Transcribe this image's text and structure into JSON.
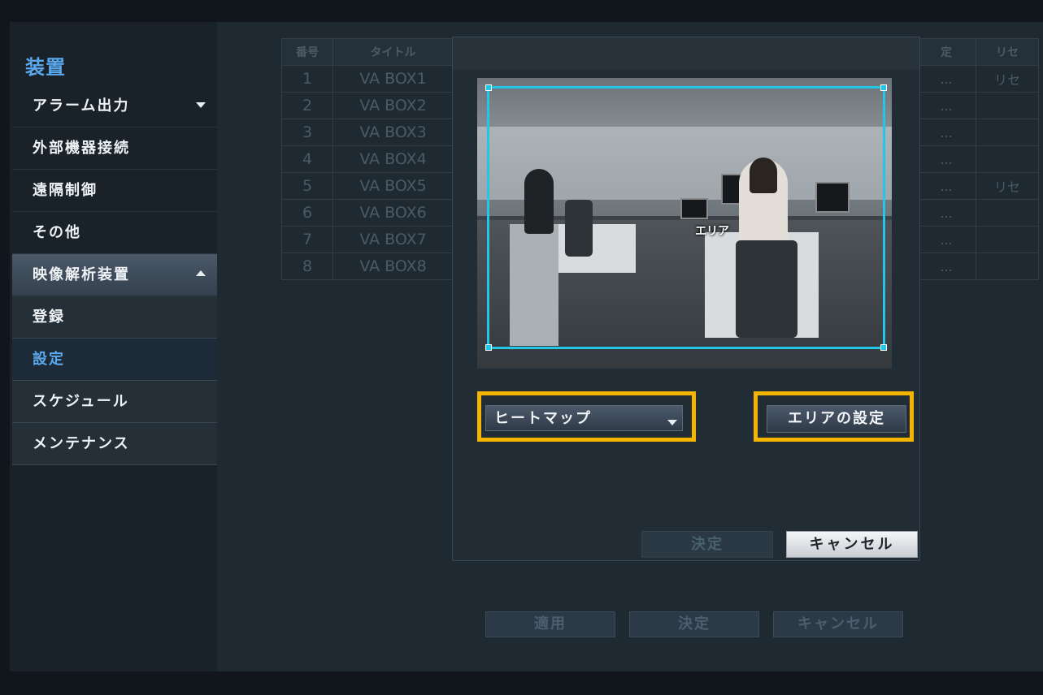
{
  "sidebar": {
    "title": "装置",
    "items": [
      {
        "label": "アラーム出力"
      },
      {
        "label": "外部機器接続"
      },
      {
        "label": "遠隔制御"
      },
      {
        "label": "その他"
      },
      {
        "label": "映像解析装置"
      },
      {
        "label": "登録"
      },
      {
        "label": "設定"
      },
      {
        "label": "スケジュール"
      },
      {
        "label": "メンテナンス"
      }
    ]
  },
  "table": {
    "headers": [
      "番号",
      "タイトル"
    ],
    "rows": [
      {
        "no": "1",
        "name": "VA BOX1"
      },
      {
        "no": "2",
        "name": "VA BOX2"
      },
      {
        "no": "3",
        "name": "VA BOX3"
      },
      {
        "no": "4",
        "name": "VA BOX4"
      },
      {
        "no": "5",
        "name": "VA BOX5"
      },
      {
        "no": "6",
        "name": "VA BOX6"
      },
      {
        "no": "7",
        "name": "VA BOX7"
      },
      {
        "no": "8",
        "name": "VA BOX8"
      }
    ],
    "right_headers": [
      "定",
      "リセ"
    ],
    "right_rows": [
      {
        "c1": "...",
        "c2": "リセ"
      },
      {
        "c1": "...",
        "c2": ""
      },
      {
        "c1": "...",
        "c2": ""
      },
      {
        "c1": "...",
        "c2": ""
      },
      {
        "c1": "...",
        "c2": "リセ"
      },
      {
        "c1": "...",
        "c2": ""
      },
      {
        "c1": "...",
        "c2": ""
      },
      {
        "c1": "...",
        "c2": ""
      }
    ]
  },
  "footer": {
    "apply": "適用",
    "ok": "決定",
    "cancel": "キャンセル"
  },
  "dialog": {
    "area_label": "エリア",
    "mode_select": "ヒートマップ",
    "area_settings_button": "エリアの設定",
    "ok": "決定",
    "cancel": "キャンセル"
  },
  "colors": {
    "accent": "#5aa8ee",
    "highlight": "#f5b400",
    "roi": "#22c6e6"
  }
}
